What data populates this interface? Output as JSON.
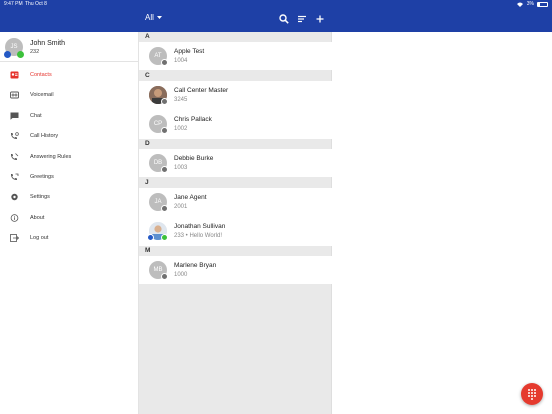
{
  "status": {
    "time": "9:47 PM",
    "date": "Thu Oct 8",
    "battery": "3%"
  },
  "header": {
    "filter_label": "All"
  },
  "user": {
    "initials": "JS",
    "name": "John Smith",
    "extension": "232"
  },
  "nav": [
    {
      "label": "Contacts",
      "icon": "contacts-icon",
      "active": true
    },
    {
      "label": "Voicemail",
      "icon": "voicemail-icon"
    },
    {
      "label": "Chat",
      "icon": "chat-icon"
    },
    {
      "label": "Call History",
      "icon": "call-history-icon"
    },
    {
      "label": "Answering Rules",
      "icon": "answering-rules-icon"
    },
    {
      "label": "Greetings",
      "icon": "greetings-icon"
    },
    {
      "label": "Settings",
      "icon": "gear-icon"
    },
    {
      "label": "About",
      "icon": "info-icon"
    },
    {
      "label": "Log out",
      "icon": "logout-icon"
    }
  ],
  "sections": [
    {
      "letter": "A",
      "contacts": [
        {
          "initials": "AT",
          "name": "Apple Test",
          "detail": "1004"
        }
      ]
    },
    {
      "letter": "C",
      "contacts": [
        {
          "initials": "",
          "name": "Call Center Master",
          "detail": "3245"
        },
        {
          "initials": "CP",
          "name": "Chris Pallack",
          "detail": "1002"
        }
      ]
    },
    {
      "letter": "D",
      "contacts": [
        {
          "initials": "DB",
          "name": "Debbie Burke",
          "detail": "1003"
        }
      ]
    },
    {
      "letter": "J",
      "contacts": [
        {
          "initials": "JA",
          "name": "Jane Agent",
          "detail": "2001"
        },
        {
          "initials": "",
          "name": "Jonathan Sullivan",
          "detail": "233 • Hello World!"
        }
      ]
    },
    {
      "letter": "M",
      "contacts": [
        {
          "initials": "MB",
          "name": "Marlene Bryan",
          "detail": "1000"
        }
      ]
    }
  ],
  "colors": {
    "header": "#1e40a6",
    "accent": "#e5322c",
    "fab": "#e53a2e"
  }
}
